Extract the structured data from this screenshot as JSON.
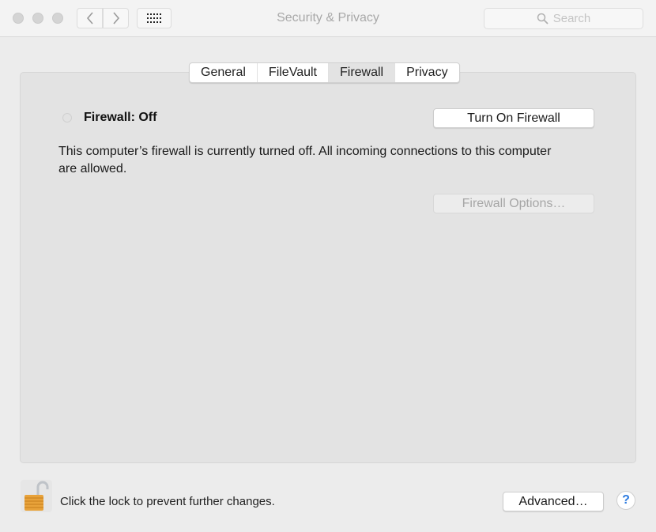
{
  "window": {
    "title": "Security & Privacy",
    "traffic_lights": [
      "close",
      "minimize",
      "zoom"
    ],
    "nav": {
      "back_icon": "chevron-left-icon",
      "forward_icon": "chevron-right-icon",
      "show_all_icon": "grid-icon"
    },
    "search": {
      "placeholder": "Search",
      "icon": "search-icon"
    }
  },
  "tabs": [
    {
      "label": "General",
      "active": false
    },
    {
      "label": "FileVault",
      "active": false
    },
    {
      "label": "Firewall",
      "active": true
    },
    {
      "label": "Privacy",
      "active": false
    }
  ],
  "firewall": {
    "status_label": "Firewall: Off",
    "description": "This computer’s firewall is currently turned off. All incoming connections to this computer are allowed.",
    "turn_on_label": "Turn On Firewall",
    "options_label": "Firewall Options…",
    "options_enabled": false
  },
  "footer": {
    "lock_icon": "unlocked-padlock-icon",
    "lock_text": "Click the lock to prevent further changes.",
    "advanced_label": "Advanced…",
    "help_label": "?"
  },
  "colors": {
    "accent_blue": "#2d7be0",
    "lock_gold": "#e8a23a"
  }
}
